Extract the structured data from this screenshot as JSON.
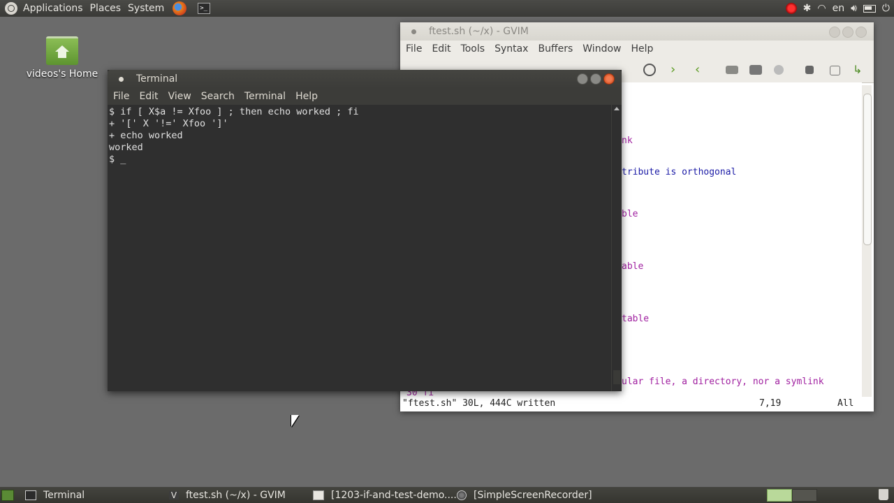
{
  "top_panel": {
    "menus": [
      "Applications",
      "Places",
      "System"
    ],
    "indicators": {
      "lang": "en"
    }
  },
  "desktop": {
    "icon_label": "videos's Home"
  },
  "gvim": {
    "title": "ftest.sh (~/x) - GVIM",
    "menus": [
      "File",
      "Edit",
      "Tools",
      "Syntax",
      "Buffers",
      "Window",
      "Help"
    ],
    "visible_lines": [
      "nk",
      "tribute is orthogonal",
      "ble",
      "able",
      "table",
      "ular file, a directory, nor a symlink"
    ],
    "partial_line": "30 fi",
    "status": {
      "message": "\"ftest.sh\" 30L, 444C written",
      "position": "7,19",
      "scroll": "All"
    }
  },
  "terminal": {
    "title": "Terminal",
    "menus": [
      "File",
      "Edit",
      "View",
      "Search",
      "Terminal",
      "Help"
    ],
    "lines": [
      "$ if [ X$a != Xfoo ] ; then echo worked ; fi",
      "+ '[' X '!=' Xfoo ']'",
      "+ echo worked",
      "worked",
      "$ _"
    ]
  },
  "taskbar": {
    "tasks": [
      {
        "label": "Terminal"
      },
      {
        "label": "ftest.sh (~/x) - GVIM"
      },
      {
        "label": "[1203-if-and-test-demo...."
      },
      {
        "label": "[SimpleScreenRecorder]"
      }
    ]
  },
  "colors": {
    "desktop": "#6b6b6b",
    "terminal_bg": "#2f2f2f",
    "vim_text": "#a020a0",
    "close_button": "#e2582a"
  }
}
